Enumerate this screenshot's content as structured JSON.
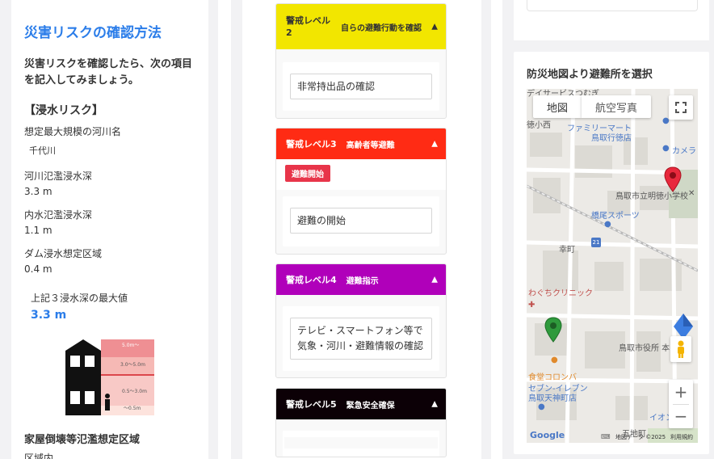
{
  "risk_check": {
    "title": "災害リスクの確認方法",
    "intro": "災害リスクを確認したら、次の項目を記入してみましょう。",
    "flood_section": "【浸水リスク】",
    "river_label": "想定最大規模の河川名",
    "river_value": "千代川",
    "river_depth_label": "河川氾濫浸水深",
    "river_depth_value": "3.3 m",
    "inland_label": "内水氾濫浸水深",
    "inland_value": "1.1 m",
    "dam_label": "ダム浸水想定区域",
    "dam_value": "0.4 m",
    "max_label": "上記３浸水深の最大値",
    "max_value": "3.3 m",
    "house_labels": [
      "5.0m〜",
      "3.0〜5.0m",
      "0.5〜3.0m",
      "〜0.5m"
    ],
    "collapse_label": "家屋倒壊等氾濫想定区域",
    "collapse_value": "区域内"
  },
  "levels": [
    {
      "name": "警戒レベル2",
      "sub": "自らの避難行動を確認",
      "arrow": "▲",
      "item": "非常持出品の確認",
      "color": "#f2e600",
      "text_color": "#333333"
    },
    {
      "name": "警戒レベル3",
      "sub": "高齢者等避難",
      "arrow": "▲",
      "badge": "避難開始",
      "item": "避難の開始",
      "color": "#ff2b14",
      "text_color": "#ffffff"
    },
    {
      "name": "警戒レベル4",
      "sub": "避難指示",
      "arrow": "▲",
      "item": "テレビ・スマートフォン等で気象・河川・避難情報の確認",
      "color": "#b000ba",
      "text_color": "#ffffff"
    },
    {
      "name": "警戒レベル5",
      "sub": "緊急安全確保",
      "arrow": "▲",
      "color": "#0c0006",
      "text_color": "#ffffff"
    }
  ],
  "map": {
    "title": "防災地図より避難所を選択",
    "btn_map": "地図",
    "btn_aerial": "航空写真",
    "labels": {
      "top_cut": "デイサービスつむぎ",
      "tokushoushi": "徳小西",
      "familymart_1": "ファミリーマート",
      "familymart_2": "鳥取行徳店",
      "camera": "カメラ",
      "school": "鳥取市立明徳小学校",
      "hashio": "橋尾スポーツ",
      "saiwaicho": "幸町",
      "route": "21",
      "clinic": "わぐちクリニック",
      "cityhall": "鳥取市役所 本",
      "colombe": "食堂コロンバ",
      "seven_1": "セブン-イレブン",
      "seven_2": "鳥取天神町店",
      "aeon": "イオン",
      "kumachi": "五地町"
    },
    "footer_data": "地図データ ©2025",
    "footer_terms": "利用規約",
    "google": "Google"
  }
}
